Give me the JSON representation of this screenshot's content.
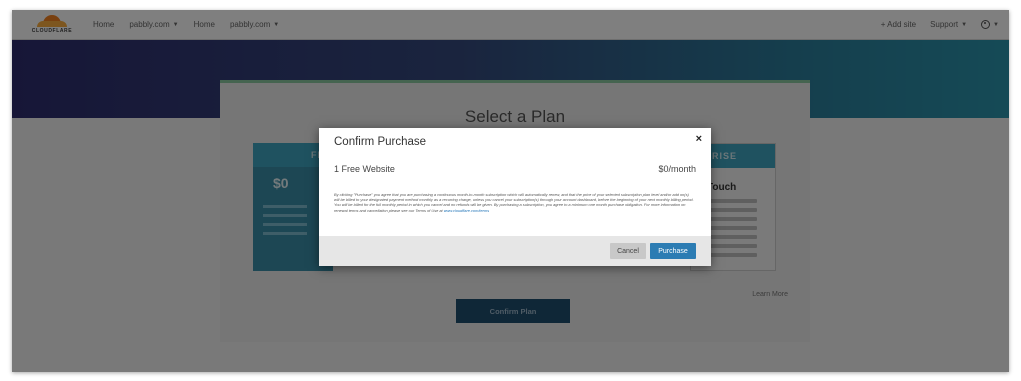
{
  "brand": {
    "logo_text": "CLOUDFLARE",
    "accent": "#f38020"
  },
  "nav": {
    "left": [
      {
        "label": "Home",
        "dropdown": false
      },
      {
        "label": "pabbly.com",
        "dropdown": true
      },
      {
        "label": "Home",
        "dropdown": false
      },
      {
        "label": "pabbly.com",
        "dropdown": true
      }
    ],
    "add_site": "+ Add site",
    "support": "Support",
    "user_icon": "user-circle-icon"
  },
  "plans": {
    "title": "Select a Plan",
    "free": {
      "head": "FR",
      "price": "$0"
    },
    "enterprise": {
      "head": "PRISE",
      "subtitle": "Touch"
    },
    "learn_more": "Learn More",
    "confirm_button": "Confirm Plan"
  },
  "modal": {
    "title": "Confirm Purchase",
    "close_symbol": "×",
    "item_name": "1 Free Website",
    "item_price": "$0/month",
    "legal_text": "By clicking \"Purchase\" you agree that you are purchasing a continuous month-to-month subscription which will automatically renew, and that the price of your selected subscription plan level and/or add on(s) will be billed to your designated payment method monthly as a recurring charge, unless you cancel your subscription(s) through your account dashboard, before the beginning of your next monthly billing period. You will be billed for the full monthly period in which you cancel and no refunds will be given. By purchasing a subscription, you agree to a minimum one month purchase obligation. For more information on renewal terms and cancellation please see our Terms of Use at",
    "legal_link": "www.cloudflare.com/terms",
    "cancel_label": "Cancel",
    "purchase_label": "Purchase"
  }
}
